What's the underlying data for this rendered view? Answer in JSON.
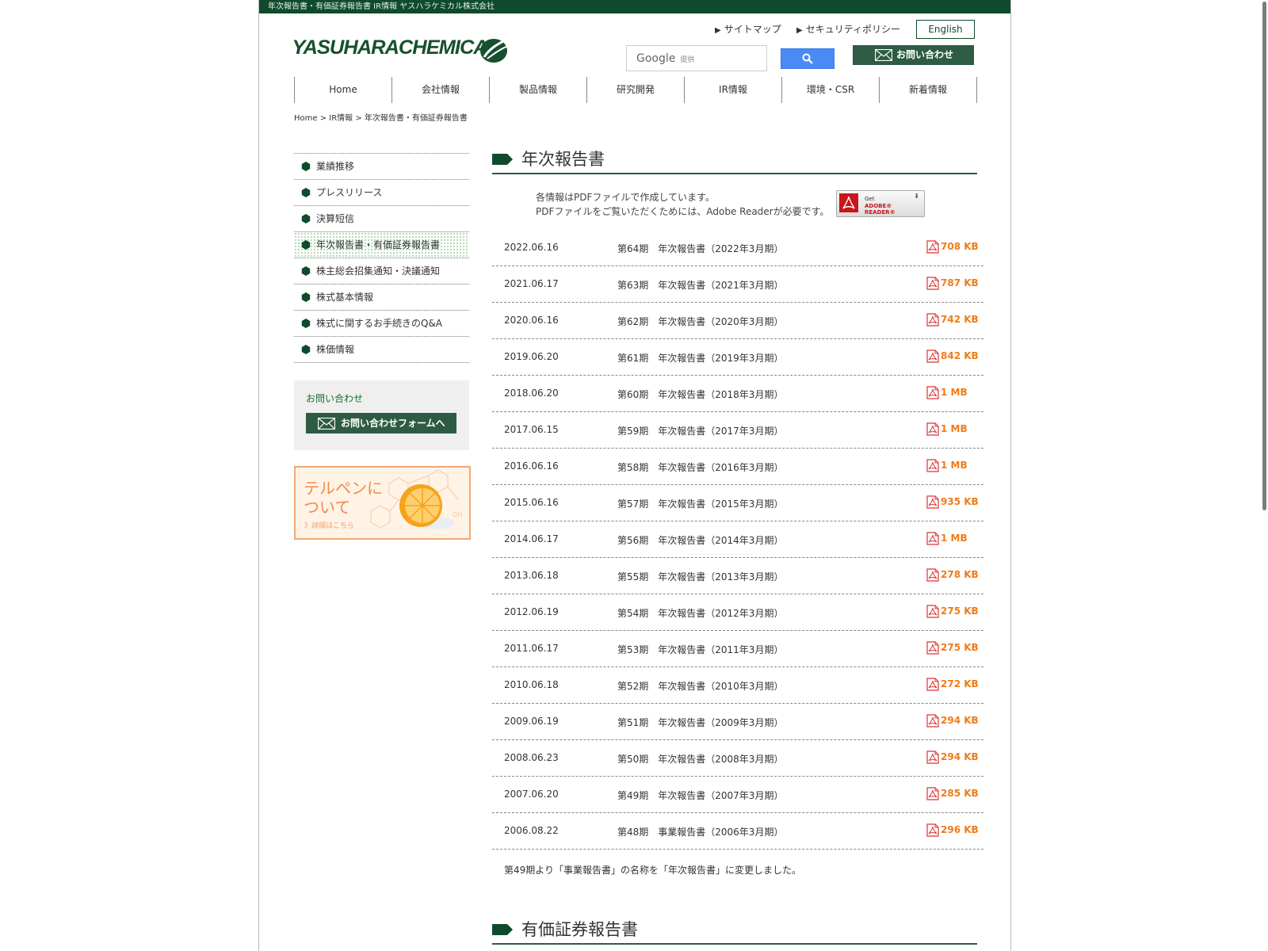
{
  "topbar": {
    "text": "年次報告書・有価証券報告書 IR情報 ヤスハラケミカル株式会社"
  },
  "logo": {
    "text": "YASUHARACHEMICAL",
    "color": "#17502f"
  },
  "util_links": [
    {
      "label": "サイトマップ"
    },
    {
      "label": "セキュリティポリシー"
    }
  ],
  "english_button": "English",
  "search": {
    "placeholder_brand": "Google",
    "placeholder_suffix": "提供"
  },
  "contact_top_label": "お問い合わせ",
  "global_nav": [
    {
      "label": "Home"
    },
    {
      "label": "会社情報"
    },
    {
      "label": "製品情報"
    },
    {
      "label": "研究開発"
    },
    {
      "label": "IR情報"
    },
    {
      "label": "環境・CSR"
    },
    {
      "label": "新着情報"
    }
  ],
  "breadcrumb": "Home > IR情報 > 年次報告書・有価証券報告書",
  "side_nav": [
    {
      "label": "業績推移",
      "active": false
    },
    {
      "label": "プレスリリース",
      "active": false
    },
    {
      "label": "決算短信",
      "active": false
    },
    {
      "label": "年次報告書・有価証券報告書",
      "active": true
    },
    {
      "label": "株主総会招集通知・決議通知",
      "active": false
    },
    {
      "label": "株式基本情報",
      "active": false
    },
    {
      "label": "株式に関するお手続きのQ&A",
      "active": false
    },
    {
      "label": "株価情報",
      "active": false
    }
  ],
  "side_contact": {
    "title": "お問い合わせ",
    "button": "お問い合わせフォームへ"
  },
  "banner": {
    "line1": "テルペンに",
    "line2": "ついて",
    "sub": "》詳細はこちら"
  },
  "section1": {
    "heading": "年次報告書",
    "pdf_note_1": "各情報はPDFファイルで作成しています。",
    "pdf_note_2": "PDFファイルをご覧いただくためには、Adobe Readerが必要です。",
    "adobe_get": "Get",
    "adobe_reader": "ADOBE® READER®",
    "rows": [
      {
        "date": "2022.06.16",
        "title": "第64期　年次報告書（2022年3月期）",
        "size": "708 KB"
      },
      {
        "date": "2021.06.17",
        "title": "第63期　年次報告書（2021年3月期）",
        "size": "787 KB"
      },
      {
        "date": "2020.06.16",
        "title": "第62期　年次報告書（2020年3月期）",
        "size": "742 KB"
      },
      {
        "date": "2019.06.20",
        "title": "第61期　年次報告書（2019年3月期）",
        "size": "842 KB"
      },
      {
        "date": "2018.06.20",
        "title": "第60期　年次報告書（2018年3月期）",
        "size": "1 MB"
      },
      {
        "date": "2017.06.15",
        "title": "第59期　年次報告書（2017年3月期）",
        "size": "1 MB"
      },
      {
        "date": "2016.06.16",
        "title": "第58期　年次報告書（2016年3月期）",
        "size": "1 MB"
      },
      {
        "date": "2015.06.16",
        "title": "第57期　年次報告書（2015年3月期）",
        "size": "935 KB"
      },
      {
        "date": "2014.06.17",
        "title": "第56期　年次報告書（2014年3月期）",
        "size": "1 MB"
      },
      {
        "date": "2013.06.18",
        "title": "第55期　年次報告書（2013年3月期）",
        "size": "278 KB"
      },
      {
        "date": "2012.06.19",
        "title": "第54期　年次報告書（2012年3月期）",
        "size": "275 KB"
      },
      {
        "date": "2011.06.17",
        "title": "第53期　年次報告書（2011年3月期）",
        "size": "275 KB"
      },
      {
        "date": "2010.06.18",
        "title": "第52期　年次報告書（2010年3月期）",
        "size": "272 KB"
      },
      {
        "date": "2009.06.19",
        "title": "第51期　年次報告書（2009年3月期）",
        "size": "294 KB"
      },
      {
        "date": "2008.06.23",
        "title": "第50期　年次報告書（2008年3月期）",
        "size": "294 KB"
      },
      {
        "date": "2007.06.20",
        "title": "第49期　年次報告書（2007年3月期）",
        "size": "285 KB"
      },
      {
        "date": "2006.08.22",
        "title": "第48期　事業報告書（2006年3月期）",
        "size": "296 KB"
      }
    ],
    "footnote": "第49期より「事業報告書」の名称を「年次報告書」に変更しました。"
  },
  "section2": {
    "heading": "有価証券報告書"
  },
  "colors": {
    "brand_green": "#0f4a2c",
    "button_green": "#2d5b43",
    "size_orange": "#f07b16",
    "search_blue": "#4a8af4"
  }
}
